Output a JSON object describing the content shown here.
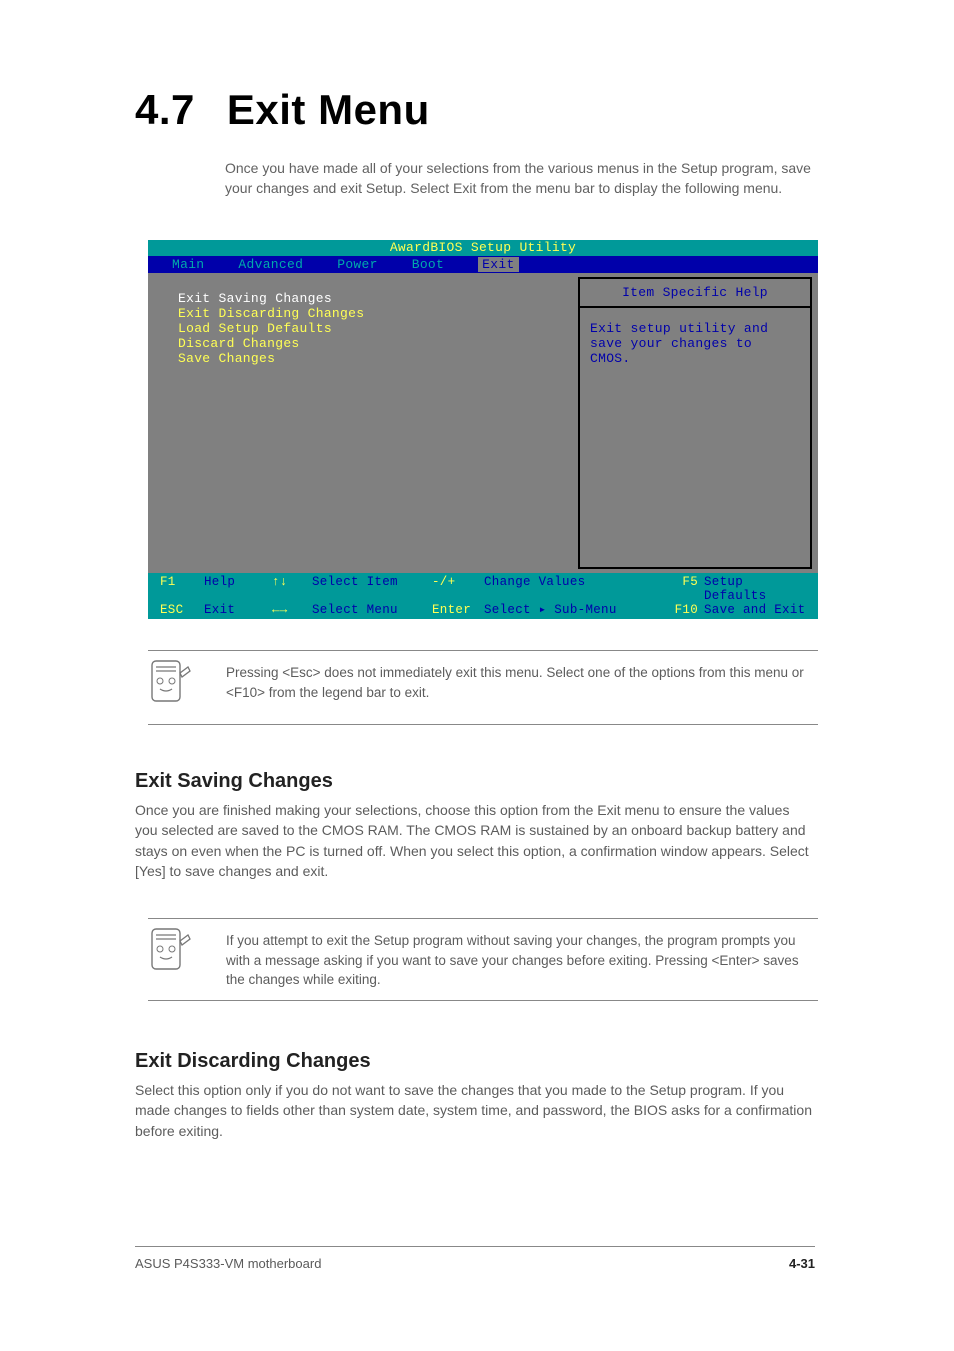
{
  "heading": {
    "number": "4.7",
    "title": "Exit Menu"
  },
  "intro": "Once you have made all of your selections from the various menus in the Setup program, save your changes and exit Setup. Select Exit from the menu bar to display the following menu.",
  "bios": {
    "title": "AwardBIOS Setup Utility",
    "tabs": [
      "Main",
      "Advanced",
      "Power",
      "Boot",
      "Exit"
    ],
    "active_tab": "Exit",
    "items": [
      "Exit Saving Changes",
      "Exit Discarding Changes",
      "Load Setup Defaults",
      "Discard Changes",
      "Save Changes"
    ],
    "selected_item": "Exit Saving Changes",
    "help": {
      "title": "Item Specific Help",
      "body": "Exit setup utility and save your changes to CMOS."
    },
    "footer": {
      "r1": {
        "k1": "F1",
        "t1": "Help",
        "ar": "↑↓",
        "t2": "Select Item",
        "k2": "-/+",
        "t3": "Change Values",
        "k3": "F5",
        "t4": "Setup Defaults"
      },
      "r2": {
        "k1": "ESC",
        "t1": "Exit",
        "ar": "←→",
        "t2": "Select Menu",
        "k2": "Enter",
        "t3": "Select ▸ Sub-Menu",
        "k3": "F10",
        "t4": "Save and Exit"
      }
    }
  },
  "note1": "Pressing <Esc> does not immediately exit this menu. Select one of the options from this menu or <F10> from the legend bar to exit.",
  "section1": {
    "heading": "Exit Saving Changes",
    "body": "Once you are finished making your selections, choose this option from the Exit menu to ensure the values you selected are saved to the CMOS RAM. The CMOS RAM is sustained by an onboard backup battery and stays on even when the PC is turned off. When you select this option, a confirmation window appears. Select [Yes] to save changes and exit."
  },
  "note2": "If you attempt to exit the Setup program without saving your changes, the program prompts you with a message asking if you want to save your changes before exiting. Pressing <Enter> saves the changes while exiting.",
  "section2": {
    "heading": "Exit Discarding Changes",
    "body": "Select this option only if you do not want to save the changes that you made to the Setup program. If you made changes to fields other than system date, system time, and password, the BIOS asks for a confirmation before exiting."
  },
  "footer": {
    "left": "ASUS P4S333-VM motherboard",
    "right": "4-31"
  }
}
